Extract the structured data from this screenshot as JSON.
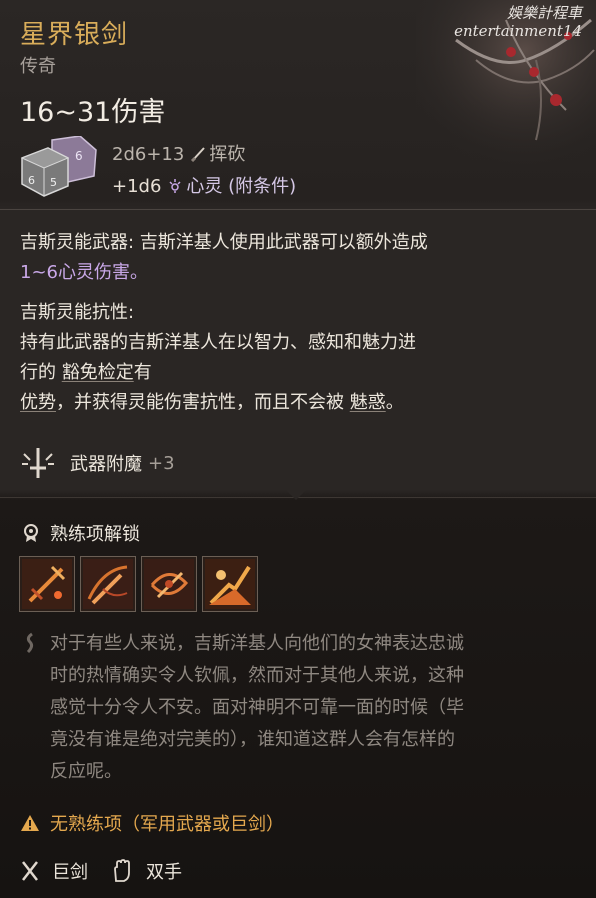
{
  "item": {
    "name": "星界银剑",
    "rarity": "传奇",
    "damage_range": "16~31伤害",
    "damage_lines": [
      {
        "dice": "2d6+13",
        "type": "挥砍",
        "icon": "slash-icon"
      },
      {
        "dice": "+1d6",
        "type": "心灵 (附条件)",
        "icon": "psychic-icon"
      }
    ]
  },
  "watermark": {
    "line1": "娛樂計程車",
    "line2": "entertainment14"
  },
  "passives": {
    "weapon_title": "吉斯灵能武器:",
    "weapon_text": " 吉斯洋基人使用此武器可以额外造成",
    "weapon_extra": "1~6心灵伤害。",
    "resist_title": "吉斯灵能抗性:",
    "resist_line1": "持有此武器的吉斯洋基人在以智力、感知和魅力进",
    "resist_line2a": "行的 ",
    "resist_line2b": "豁免检定",
    "resist_line2c": "有",
    "resist_line3a": "优势",
    "resist_line3b": "，并获得灵能伤害抗性，而且不会被 ",
    "resist_line3c": "魅惑",
    "resist_line3d": "。"
  },
  "enchantment": {
    "label": "武器附魔",
    "value": "+3"
  },
  "proficiency": {
    "header": "熟练项解锁",
    "actions": [
      "action-1",
      "action-2",
      "action-3",
      "action-4"
    ]
  },
  "lore": {
    "lines": [
      "对于有些人来说，吉斯洋基人向他们的女神表达忠诚",
      "时的热情确实令人钦佩，然而对于其他人来说，这种",
      "感觉十分令人不安。面对神明不可靠一面的时候（毕",
      "竟没有谁是绝对完美的），谁知道这群人会有怎样的",
      "反应呢。"
    ]
  },
  "warning": "无熟练项（军用武器或巨剑）",
  "traits": [
    "巨剑",
    "双手"
  ],
  "colors": {
    "title": "#d9ad5a",
    "psychic": "#c9a8e8",
    "warning": "#e4a84e"
  }
}
